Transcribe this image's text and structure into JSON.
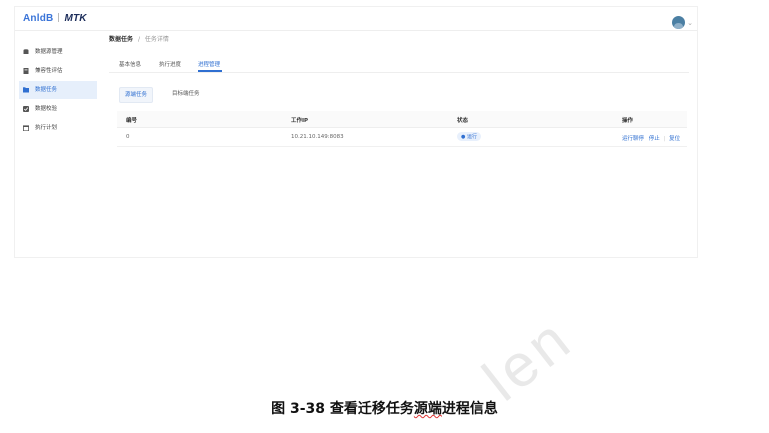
{
  "brand": {
    "left": "AnldB",
    "right": "MTK"
  },
  "sidebar": {
    "items": [
      {
        "label": "数据源管理",
        "icon": "database-icon"
      },
      {
        "label": "兼容性评估",
        "icon": "report-icon"
      },
      {
        "label": "数据任务",
        "icon": "folder-icon"
      },
      {
        "label": "数据校验",
        "icon": "check-icon"
      },
      {
        "label": "执行计划",
        "icon": "calendar-icon"
      }
    ],
    "active_index": 2
  },
  "breadcrumb": {
    "root": "数据任务",
    "separator": "/",
    "current": "任务详情"
  },
  "tabs": [
    "基本信息",
    "执行进度",
    "进程管理"
  ],
  "active_tab": 2,
  "subtabs": [
    "源端任务",
    "目标端任务"
  ],
  "active_subtab": 0,
  "table": {
    "headers": [
      "编号",
      "工作IP",
      "状态",
      "操作"
    ],
    "rows": [
      {
        "id": "0",
        "ip": "10.21.10.149:8083",
        "status": "运行",
        "actions": [
          "运行聊停",
          "停止",
          "复位"
        ]
      }
    ]
  },
  "caption": {
    "prefix": "图 3-38  查看迁移任务",
    "tail": "源端",
    "suffix": "进程信息"
  },
  "watermark": "len",
  "colors": {
    "accent": "#2f6fd1",
    "active_bg": "#e6effb"
  }
}
